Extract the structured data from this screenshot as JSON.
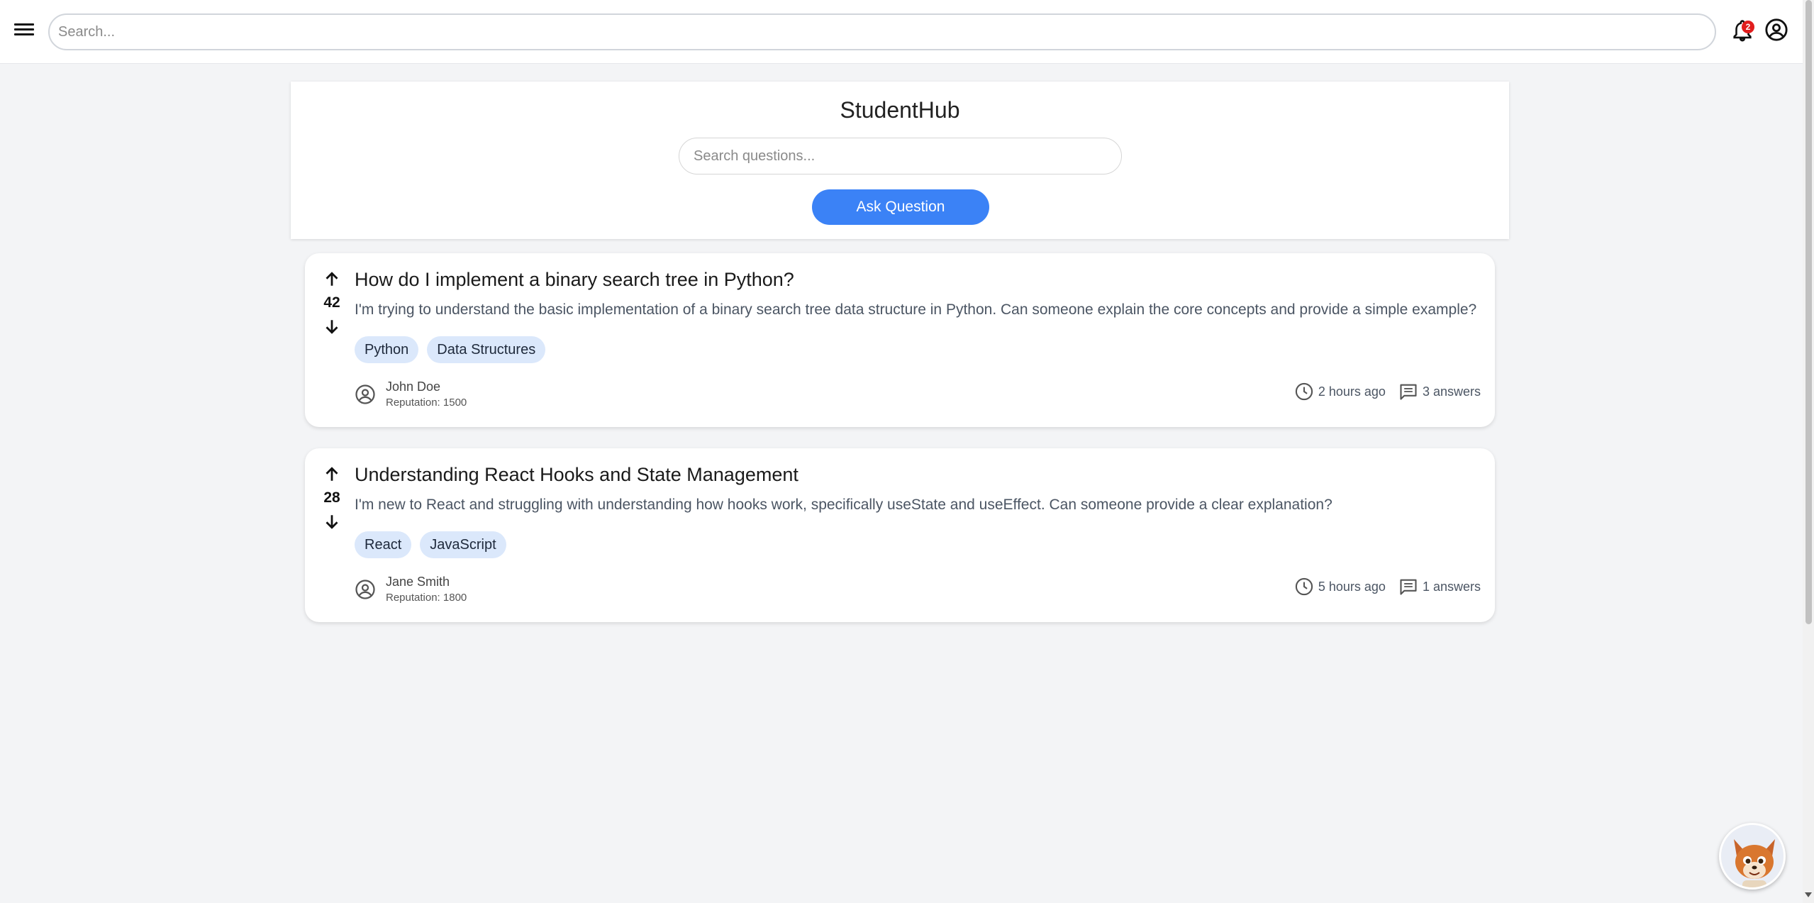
{
  "topbar": {
    "search_placeholder": "Search...",
    "notification_count": "2"
  },
  "hub": {
    "title": "StudentHub",
    "search_placeholder": "Search questions...",
    "ask_button": "Ask Question"
  },
  "questions": [
    {
      "votes": "42",
      "title": "How do I implement a binary search tree in Python?",
      "body": "I'm trying to understand the basic implementation of a binary search tree data structure in Python. Can someone explain the core concepts and provide a simple example?",
      "tags": [
        "Python",
        "Data Structures"
      ],
      "author": "John Doe",
      "reputation": "Reputation: 1500",
      "time": "2 hours ago",
      "answers": "3 answers"
    },
    {
      "votes": "28",
      "title": "Understanding React Hooks and State Management",
      "body": "I'm new to React and struggling with understanding how hooks work, specifically useState and useEffect. Can someone provide a clear explanation?",
      "tags": [
        "React",
        "JavaScript"
      ],
      "author": "Jane Smith",
      "reputation": "Reputation: 1800",
      "time": "5 hours ago",
      "answers": "1 answers"
    }
  ],
  "colors": {
    "accent": "#3b82f6",
    "tag_bg": "#dbe8fb",
    "badge": "#e11d1d"
  }
}
